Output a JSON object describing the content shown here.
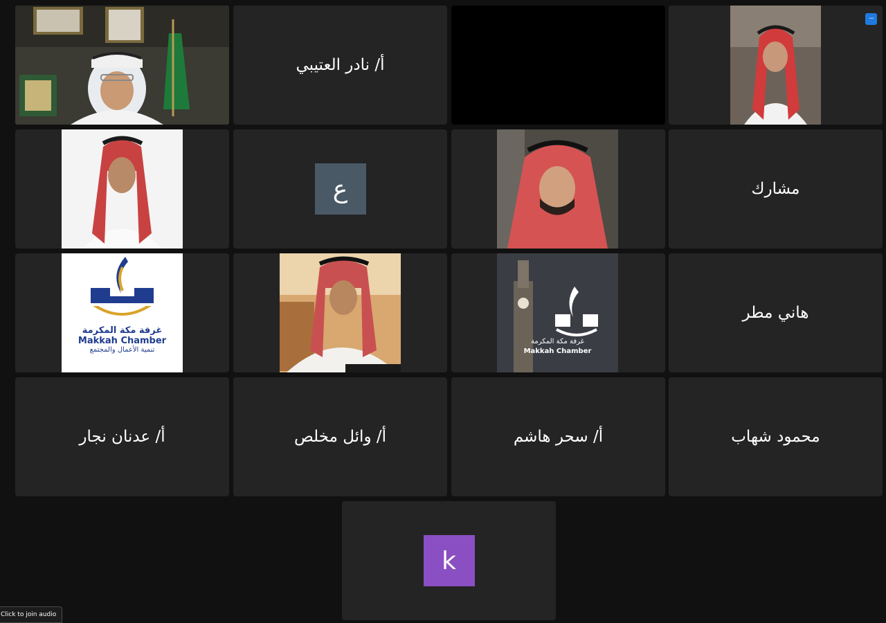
{
  "gallery": {
    "tiles": [
      {
        "kind": "video",
        "label": "participant-video-1"
      },
      {
        "kind": "name",
        "name": "أ/ نادر العتيبي"
      },
      {
        "kind": "blank"
      },
      {
        "kind": "photo",
        "label": "participant-photo-1"
      },
      {
        "kind": "photo",
        "label": "participant-photo-2"
      },
      {
        "kind": "avatar",
        "letter": "ع",
        "avatar_color": "#4a5966"
      },
      {
        "kind": "photo",
        "label": "participant-photo-3"
      },
      {
        "kind": "name",
        "name": "مشارك"
      },
      {
        "kind": "logo",
        "logo_text_ar": "غرفة مكة المكرمة",
        "logo_text_en": "Makkah Chamber",
        "logo_tagline": "تنمية الأعمال والمجتمع"
      },
      {
        "kind": "photo",
        "label": "participant-photo-4"
      },
      {
        "kind": "logo-dark",
        "logo_text_ar": "غرفة مكة المكرمة",
        "logo_text_en": "Makkah Chamber"
      },
      {
        "kind": "name",
        "name": "هاني مطر"
      },
      {
        "kind": "name",
        "name": "أ/ عدنان نجار"
      },
      {
        "kind": "name",
        "name": "أ/ وائل مخلص"
      },
      {
        "kind": "name",
        "name": "أ/ سحر هاشم"
      },
      {
        "kind": "name",
        "name": "محمود شهاب"
      },
      {
        "kind": "avatar",
        "letter": "k",
        "avatar_color": "#8a4fc3"
      }
    ]
  },
  "colors": {
    "background": "#111111",
    "tile": "#242424",
    "active_speaker_border": "#3fd14a",
    "more_button": "#1f7ae0"
  },
  "controls": {
    "more_icon": "...",
    "join_audio_label": "Click to join audio"
  }
}
